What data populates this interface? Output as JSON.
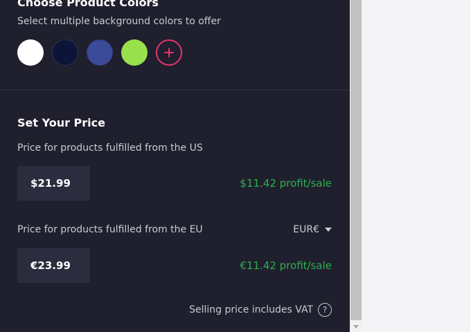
{
  "colors_section": {
    "title": "Choose Product Colors",
    "subtitle": "Select multiple background colors to offer",
    "swatches": [
      {
        "name": "white",
        "hex": "#ffffff"
      },
      {
        "name": "navy",
        "hex": "#0c1538"
      },
      {
        "name": "royal-blue",
        "hex": "#3b4b9a"
      },
      {
        "name": "lime-green",
        "hex": "#99e04d"
      }
    ],
    "add_button_icon": "plus-icon",
    "accent_color": "#e8336b"
  },
  "price_section": {
    "title": "Set Your Price",
    "us": {
      "label": "Price for products fulfilled from the US",
      "value": "$21.99",
      "profit": "$11.42 profit/sale"
    },
    "eu": {
      "label": "Price for products fulfilled from the EU",
      "currency": "EUR€",
      "value": "€23.99",
      "profit": "€11.42 profit/sale"
    },
    "vat_note": "Selling price includes VAT",
    "help_icon": "question-circle-icon",
    "profit_color": "#2bb24c"
  },
  "theme": {
    "panel_bg": "#1f1f2e",
    "input_bg": "#2c2c3f",
    "text_muted": "#c9cbd6"
  }
}
